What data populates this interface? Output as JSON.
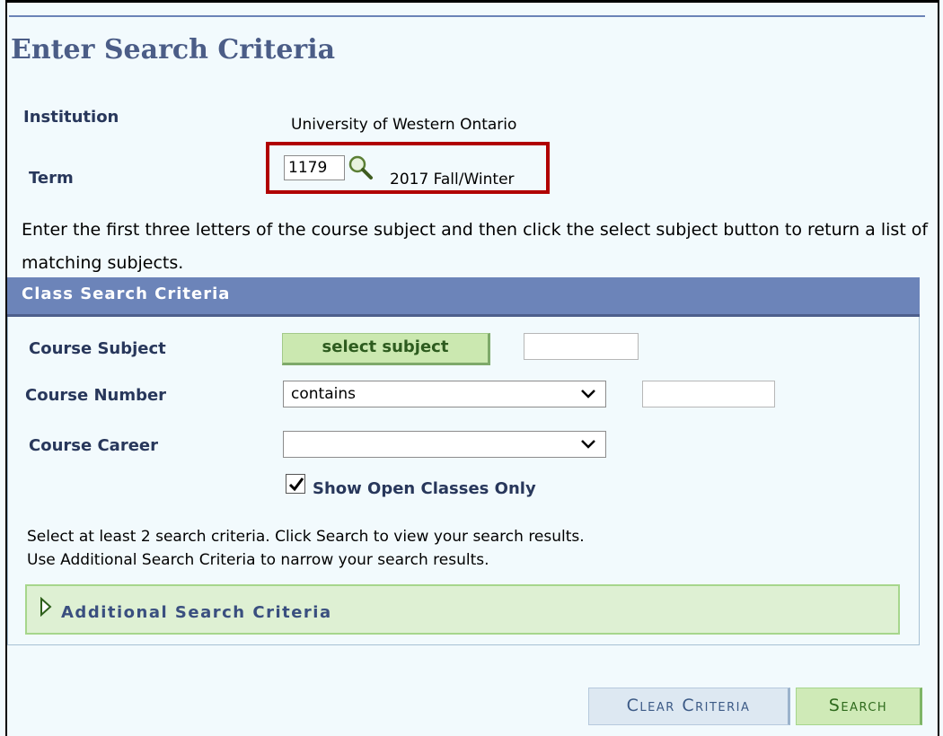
{
  "page": {
    "title": "Enter Search Criteria"
  },
  "institution": {
    "label": "Institution",
    "value": "University of Western Ontario"
  },
  "term": {
    "label": "Term",
    "code": "1179",
    "description": "2017 Fall/Winter",
    "lookup_icon": "magnifier-icon",
    "highlight_color": "#b00000"
  },
  "instruction": "Enter the first three letters of the course subject and then click the select subject button to return a list of matching subjects.",
  "criteria_panel": {
    "header": "Class Search Criteria",
    "course_subject": {
      "label": "Course Subject",
      "button_label": "select subject",
      "value": ""
    },
    "course_number": {
      "label": "Course Number",
      "operator": "contains",
      "value": ""
    },
    "course_career": {
      "label": "Course Career",
      "value": ""
    },
    "open_classes": {
      "label": "Show Open Classes Only",
      "checked": true
    },
    "help_line1": "Select at least 2 search criteria. Click Search to view your search results.",
    "help_line2": "Use Additional Search Criteria to narrow your search results.",
    "additional": {
      "label": "Additional Search Criteria",
      "icon": "expand-triangle-icon"
    }
  },
  "actions": {
    "clear_label": "Clear Criteria",
    "search_label": "Search"
  },
  "colors": {
    "header_bg": "#6c84b9",
    "title_color": "#4b5d87",
    "label_color": "#28375b",
    "green_button": "#cbe8b0"
  }
}
